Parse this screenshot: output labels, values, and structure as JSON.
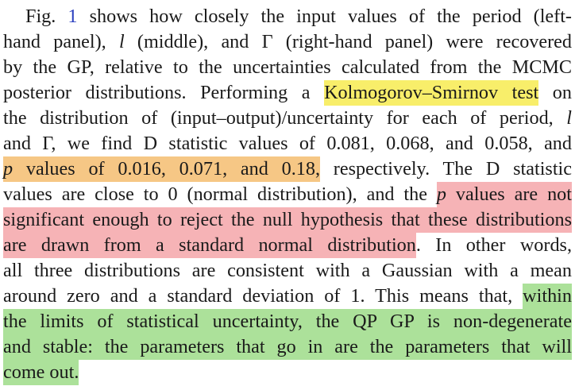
{
  "top_cut_line": "previous text partially visible",
  "paragraph": {
    "lines": [
      [
        {
          "t": "Fig. "
        },
        {
          "t": "1",
          "c": "ref"
        },
        {
          "t": " shows how closely the input values of the period (left-"
        }
      ],
      [
        {
          "t": "hand panel), "
        },
        {
          "t": "l",
          "c": "it"
        },
        {
          "t": " (middle), and Γ (right-hand panel) were recovered"
        }
      ],
      [
        {
          "t": "by the GP, relative to the uncertainties calculated from the MCMC"
        }
      ],
      [
        {
          "t": "posterior distributions. Performing a "
        },
        {
          "t": "Kolmogorov–Smirnov test",
          "c": "hl-yellow"
        },
        {
          "t": " on"
        }
      ],
      [
        {
          "t": "the distribution of (input–output)/uncertainty for each of period, "
        },
        {
          "t": "l",
          "c": "it"
        }
      ],
      [
        {
          "t": "and Γ, we find D statistic values of 0.081, 0.068, and 0.058, and"
        }
      ],
      [
        {
          "t": "p",
          "c": "hl-orange it"
        },
        {
          "t": " values of 0.016, 0.071, and 0.18,",
          "c": "hl-orange"
        },
        {
          "t": " respectively. The D statistic"
        }
      ],
      [
        {
          "t": "values are close to 0 (normal distribution), and the "
        },
        {
          "t": "p",
          "c": "hl-red it"
        },
        {
          "t": " values are not",
          "c": "hl-red"
        }
      ],
      [
        {
          "t": "significant enough to reject the null hypothesis that these distributions",
          "c": "hl-red"
        }
      ],
      [
        {
          "t": "are drawn from a standard normal distribution",
          "c": "hl-red"
        },
        {
          "t": ". In other words,"
        }
      ],
      [
        {
          "t": "all three distributions are consistent with a Gaussian with a mean"
        }
      ],
      [
        {
          "t": "around zero and a standard deviation of 1. This means that, "
        },
        {
          "t": "within",
          "c": "hl-green"
        }
      ],
      [
        {
          "t": "the limits of statistical uncertainty, the QP GP is non-degenerate",
          "c": "hl-green"
        }
      ],
      [
        {
          "t": "and stable: the parameters that go in are the parameters that will",
          "c": "hl-green"
        }
      ],
      [
        {
          "t": "come out.",
          "c": "hl-green"
        }
      ]
    ]
  }
}
